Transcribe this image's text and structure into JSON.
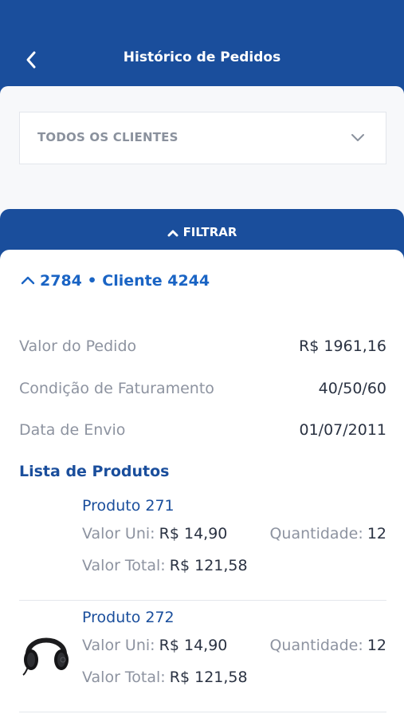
{
  "header": {
    "title": "Histórico de Pedidos"
  },
  "client_select": {
    "selected": "TODOS OS CLIENTES"
  },
  "filter": {
    "label": "FILTRAR"
  },
  "order": {
    "title": "2784 • Cliente 4244",
    "fields": [
      {
        "label": "Valor do Pedido",
        "value": "R$ 1961,16"
      },
      {
        "label": "Condição de Faturamento",
        "value": "40/50/60"
      },
      {
        "label": "Data de Envio",
        "value": "01/07/2011"
      }
    ]
  },
  "products": {
    "heading": "Lista de Produtos",
    "unit_label": "Valor Uni:",
    "qty_label": "Quantidade:",
    "total_label": "Valor Total:",
    "items": [
      {
        "name": "Produto 271",
        "unit_price": "R$ 14,90",
        "quantity": "12",
        "total": "R$ 121,58",
        "image": "none"
      },
      {
        "name": "Produto 272",
        "unit_price": "R$ 14,90",
        "quantity": "12",
        "total": "R$ 121,58",
        "image": "headphones-icon"
      }
    ]
  },
  "colors": {
    "primary": "#1a4e9c",
    "link": "#1a64c4",
    "label": "#8d93a0",
    "value": "#2a3242"
  }
}
